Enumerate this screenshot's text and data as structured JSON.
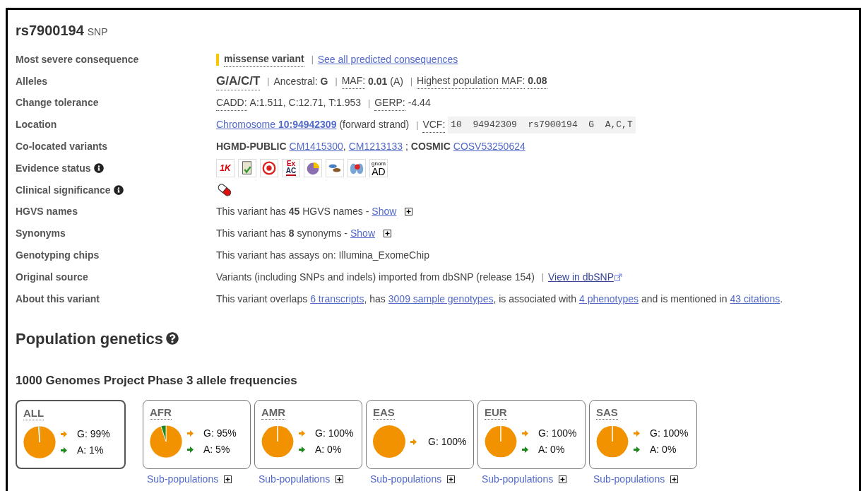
{
  "title": {
    "id": "rs7900194",
    "type": "SNP"
  },
  "rows": [
    {
      "label": "Most severe consequence",
      "info": false,
      "parts": [
        {
          "kind": "consequence",
          "text": "missense variant",
          "color": "#f5c800"
        },
        {
          "kind": "sep",
          "text": "|"
        },
        {
          "kind": "link",
          "text": "See all predicted consequences"
        }
      ]
    },
    {
      "label": "Alleles",
      "info": false,
      "parts": [
        {
          "kind": "big",
          "text": "G/A/C/T"
        },
        {
          "kind": "sep",
          "text": "|"
        },
        {
          "kind": "text",
          "text": "Ancestral: **G**"
        },
        {
          "kind": "sep",
          "text": "|"
        },
        {
          "kind": "dotted",
          "text": "MAF:"
        },
        {
          "kind": "text",
          "text": "**0.01** (A)"
        },
        {
          "kind": "sep",
          "text": "|"
        },
        {
          "kind": "dotted",
          "text": "Highest population MAF:"
        },
        {
          "kind": "dotted",
          "text": "**0.08**"
        }
      ]
    },
    {
      "label": "Change tolerance",
      "info": false,
      "parts": [
        {
          "kind": "dotted",
          "text": "CADD:"
        },
        {
          "kind": "text",
          "text": "A:1.511, C:12.71, T:1.953"
        },
        {
          "kind": "sep",
          "text": "|"
        },
        {
          "kind": "dotted",
          "text": "GERP:"
        },
        {
          "kind": "text",
          "text": "-4.44"
        }
      ]
    },
    {
      "label": "Location",
      "info": false,
      "parts": [
        {
          "kind": "link",
          "text": "Chromosome **10:94942309**"
        },
        {
          "kind": "text",
          "text": "(forward strand)"
        },
        {
          "kind": "sep",
          "text": "|"
        },
        {
          "kind": "dotted",
          "text": "VCF:"
        },
        {
          "kind": "mono",
          "text": "10  94942309  rs7900194  G  A,C,T"
        }
      ]
    },
    {
      "label": "Co-located variants",
      "info": false,
      "parts": [
        {
          "kind": "text",
          "text": "**HGMD-PUBLIC**"
        },
        {
          "kind": "link",
          "text": "CM1415300"
        },
        {
          "kind": "glue",
          "text": ","
        },
        {
          "kind": "link",
          "text": "CM1213133"
        },
        {
          "kind": "text",
          "text": "; **COSMIC**"
        },
        {
          "kind": "link",
          "text": "COSV53250624"
        }
      ]
    },
    {
      "label": "Evidence status",
      "info": true,
      "evidence": [
        {
          "kind": "thousand_genomes",
          "lines": [
            "1K"
          ]
        },
        {
          "kind": "cited"
        },
        {
          "kind": "target"
        },
        {
          "kind": "exac",
          "lines": [
            "Ex",
            "AC"
          ]
        },
        {
          "kind": "pie"
        },
        {
          "kind": "eye"
        },
        {
          "kind": "lungs"
        },
        {
          "kind": "gnomad",
          "lines": [
            "gnom",
            "AD"
          ]
        }
      ]
    },
    {
      "label": "Clinical significance",
      "info": true,
      "clinical": [
        {
          "kind": "pill"
        }
      ]
    },
    {
      "label": "HGVS names",
      "info": false,
      "parts": [
        {
          "kind": "text",
          "text": "This variant has **45** HGVS names -"
        },
        {
          "kind": "link",
          "text": "Show"
        },
        {
          "kind": "toggle",
          "expanded": false
        }
      ]
    },
    {
      "label": "Synonyms",
      "info": false,
      "parts": [
        {
          "kind": "text",
          "text": "This variant has **8** synonyms -"
        },
        {
          "kind": "link",
          "text": "Show"
        },
        {
          "kind": "toggle",
          "expanded": false
        }
      ]
    },
    {
      "label": "Genotyping chips",
      "info": false,
      "parts": [
        {
          "kind": "text",
          "text": "This variant has assays on: Illumina_ExomeChip"
        }
      ]
    },
    {
      "label": "Original source",
      "info": false,
      "parts": [
        {
          "kind": "text",
          "text": "Variants (including SNPs and indels) imported from dbSNP (release 154)"
        },
        {
          "kind": "sep",
          "text": "|"
        },
        {
          "kind": "ext_link",
          "text": "View in dbSNP"
        }
      ]
    },
    {
      "label": "About this variant",
      "info": false,
      "parts": [
        {
          "kind": "text",
          "text": "This variant overlaps"
        },
        {
          "kind": "link",
          "text": "6 transcripts"
        },
        {
          "kind": "glue",
          "text": ", has"
        },
        {
          "kind": "link",
          "text": "3009 sample genotypes"
        },
        {
          "kind": "glue",
          "text": ", is associated with"
        },
        {
          "kind": "link",
          "text": "4 phenotypes"
        },
        {
          "kind": "text",
          "text": "and is mentioned in"
        },
        {
          "kind": "link",
          "text": "43 citations"
        },
        {
          "kind": "glue",
          "text": "."
        }
      ]
    }
  ],
  "population": {
    "heading": "Population genetics",
    "subheading": "1000 Genomes Project Phase 3 allele frequencies",
    "cards": [
      {
        "name": "ALL",
        "selected": true,
        "chart_data": {
          "type": "pie",
          "categories": [
            "G: 99%",
            "A: 1%"
          ],
          "values": [
            99,
            1
          ],
          "colors": [
            "#f39200",
            "#1e8a1e"
          ]
        }
      },
      {
        "name": "AFR",
        "selected": false,
        "sub_link": "Sub-populations",
        "chart_data": {
          "type": "pie",
          "categories": [
            "G: 95%",
            "A: 5%"
          ],
          "values": [
            95,
            5
          ],
          "colors": [
            "#f39200",
            "#1e8a1e"
          ]
        }
      },
      {
        "name": "AMR",
        "selected": false,
        "sub_link": "Sub-populations",
        "chart_data": {
          "type": "pie",
          "categories": [
            "G: 100%",
            "A: 0%"
          ],
          "values": [
            100,
            0
          ],
          "colors": [
            "#f39200",
            "#1e8a1e"
          ]
        }
      },
      {
        "name": "EAS",
        "selected": false,
        "sub_link": "Sub-populations",
        "chart_data": {
          "type": "pie",
          "categories": [
            "G: 100%"
          ],
          "values": [
            100
          ],
          "colors": [
            "#f39200"
          ]
        }
      },
      {
        "name": "EUR",
        "selected": false,
        "sub_link": "Sub-populations",
        "chart_data": {
          "type": "pie",
          "categories": [
            "G: 100%",
            "A: 0%"
          ],
          "values": [
            100,
            0
          ],
          "colors": [
            "#f39200",
            "#1e8a1e"
          ]
        }
      },
      {
        "name": "SAS",
        "selected": false,
        "sub_link": "Sub-populations",
        "chart_data": {
          "type": "pie",
          "categories": [
            "G: 100%",
            "A: 0%"
          ],
          "values": [
            100,
            0
          ],
          "colors": [
            "#f39200",
            "#1e8a1e"
          ]
        }
      }
    ]
  }
}
